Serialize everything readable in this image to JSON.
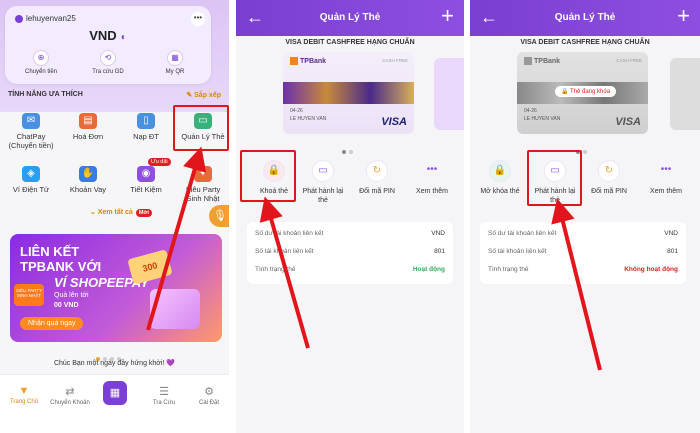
{
  "screen1": {
    "username": "lehuyenvan25",
    "balance": "VND",
    "quick_actions": [
      {
        "label": "Chuyển tiền",
        "icon": "transfer-icon"
      },
      {
        "label": "Tra cứu GD",
        "icon": "history-icon"
      },
      {
        "label": "My QR",
        "icon": "qr-icon"
      }
    ],
    "section_title": "TÍNH NĂNG ƯA THÍCH",
    "sort_label": "Sắp xếp",
    "features": [
      {
        "label": "ChatPay\n(Chuyển tiền)",
        "color": "#4a90e2"
      },
      {
        "label": "Hoá Đơn",
        "color": "#e86a3a"
      },
      {
        "label": "Nạp ĐT",
        "color": "#4a90e2"
      },
      {
        "label": "Quản Lý Thẻ",
        "color": "#3ab07a"
      },
      {
        "label": "Ví Điện Tử",
        "color": "#2a9df4"
      },
      {
        "label": "Khoản Vay",
        "color": "#3a7be0"
      },
      {
        "label": "Tiết Kiệm",
        "color": "#8e4fe0"
      },
      {
        "label": "Siêu Party\nSinh Nhật",
        "color": "#e86a3a"
      }
    ],
    "badge_uudai": "Ưu đãi",
    "see_all": "Xem tất cả",
    "badge_new": "Mới",
    "banner": {
      "line1": "LIÊN KẾT",
      "line2": "TPBANK VỚI",
      "line3": "VÍ SHOPEEPAY",
      "line4": "Quà lên tới",
      "line5": "00 VND",
      "button": "Nhận quà ngay",
      "sticker": "SIÊU PARTY SINH NHẬT",
      "voucher": "300"
    },
    "greeting": "Chúc Bạn một ngày đầy hứng khởi! 💜",
    "tabs": [
      {
        "label": "Trang Chủ",
        "icon": "▼"
      },
      {
        "label": "Chuyển Khoản",
        "icon": "⇄"
      },
      {
        "label": "",
        "icon": "▦"
      },
      {
        "label": "Tra Cứu",
        "icon": "☰"
      },
      {
        "label": "Cài Đặt",
        "icon": "⚙"
      }
    ]
  },
  "screen2": {
    "title": "Quản Lý Thẻ",
    "card_title": "VISA DEBIT CASHFREE HẠNG CHUẨN",
    "card": {
      "bank": "TPBank",
      "cashfree": "CASH FREE",
      "expiry": "04-26",
      "holder": "LE HUYEN VAN",
      "network": "VISA"
    },
    "actions": [
      {
        "label": "Khoá thẻ",
        "icon": "🔒"
      },
      {
        "label": "Phát hành lại\nthẻ",
        "icon": "▭"
      },
      {
        "label": "Đổi mã PIN",
        "icon": "↻"
      },
      {
        "label": "Xem thêm",
        "icon": "•••"
      }
    ],
    "info": [
      {
        "label": "Số dư tài khoản liên kết",
        "value": "VND"
      },
      {
        "label": "Số tài khoản liên kết",
        "value": "801"
      },
      {
        "label": "Tình trạng thẻ",
        "value": "Hoạt động"
      }
    ],
    "status_color": "#2eae5e"
  },
  "screen3": {
    "title": "Quản Lý Thẻ",
    "card_title": "VISA DEBIT CASHFREE HẠNG CHUẨN",
    "card": {
      "bank": "TPBank",
      "cashfree": "CASH FREE",
      "expiry": "04-26",
      "holder": "LE HUYEN VAN",
      "network": "VISA",
      "locked_label": "Thẻ đang khóa"
    },
    "actions": [
      {
        "label": "Mở khóa thẻ",
        "icon": "🔒"
      },
      {
        "label": "Phát hành lại\nthẻ",
        "icon": "▭"
      },
      {
        "label": "Đổi mã PIN",
        "icon": "↻"
      },
      {
        "label": "Xem thêm",
        "icon": "•••"
      }
    ],
    "info": [
      {
        "label": "Số dư tài khoản liên kết",
        "value": "VND"
      },
      {
        "label": "Số tài khoản liên kết",
        "value": "801"
      },
      {
        "label": "Tình trạng thẻ",
        "value": "Không hoạt động"
      }
    ],
    "status_color": "#e02020"
  },
  "accent": "#7b3fd6",
  "highlight": "#e0161c"
}
